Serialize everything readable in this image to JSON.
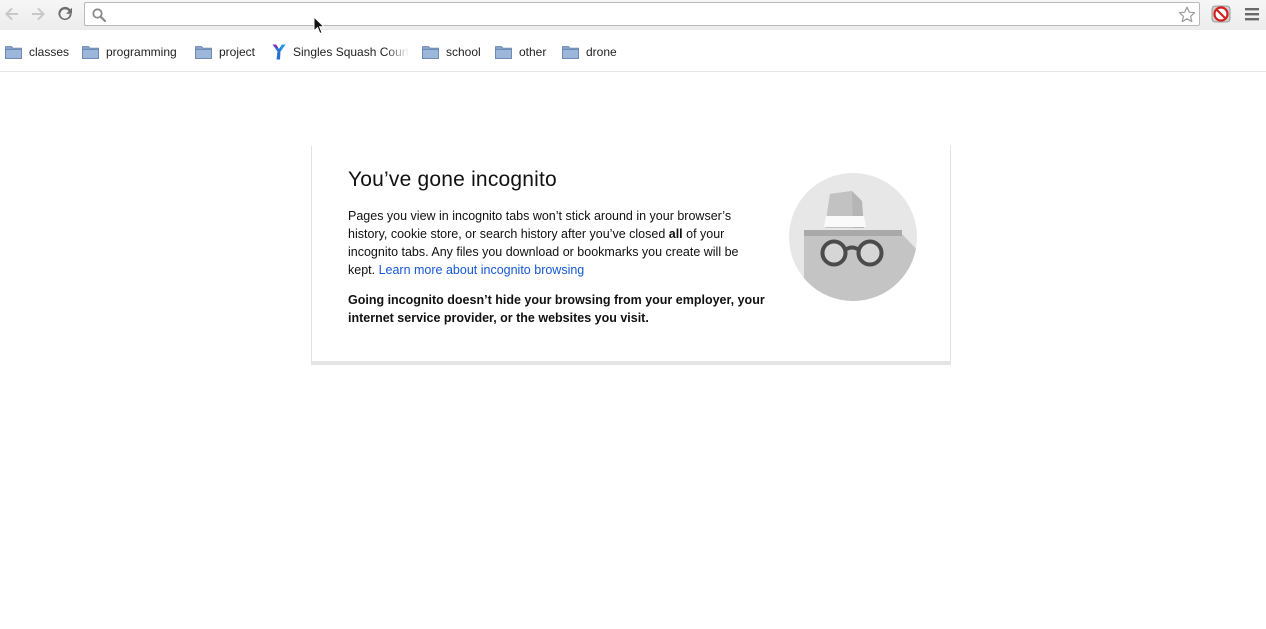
{
  "toolbar": {
    "back_icon": "arrow-left-icon",
    "forward_icon": "arrow-right-icon",
    "reload_icon": "reload-icon",
    "omnibox_value": "",
    "bookmark_star_icon": "star-outline-icon",
    "extension_icon": "adblock-icon",
    "menu_icon": "hamburger-menu-icon"
  },
  "bookmarks": [
    {
      "label": "classes",
      "icon": "folder-icon"
    },
    {
      "label": "programming",
      "icon": "folder-icon"
    },
    {
      "label": "project",
      "icon": "folder-icon"
    },
    {
      "label": "Singles Squash Court",
      "icon": "ymca-icon"
    },
    {
      "label": "school",
      "icon": "folder-icon"
    },
    {
      "label": "other",
      "icon": "folder-icon"
    },
    {
      "label": "drone",
      "icon": "folder-icon"
    }
  ],
  "incognito": {
    "title": "You’ve gone incognito",
    "text_part1": "Pages you view in incognito tabs won’t stick around in your browser’s history, cookie store, or search history after you’ve closed ",
    "text_bold": "all",
    "text_part2": " of your incognito tabs. Any files you download or bookmarks you create will be kept. ",
    "learn_more_link": "Learn more about incognito browsing",
    "warning": "Going incognito doesn’t hide your browsing from your employer, your internet service provider, or the websites you visit.",
    "illustration_icon": "incognito-spy-icon"
  },
  "colors": {
    "link": "#1558d6",
    "folder": "#7b9bc8",
    "illustration_circle": "#e7e7e7"
  }
}
